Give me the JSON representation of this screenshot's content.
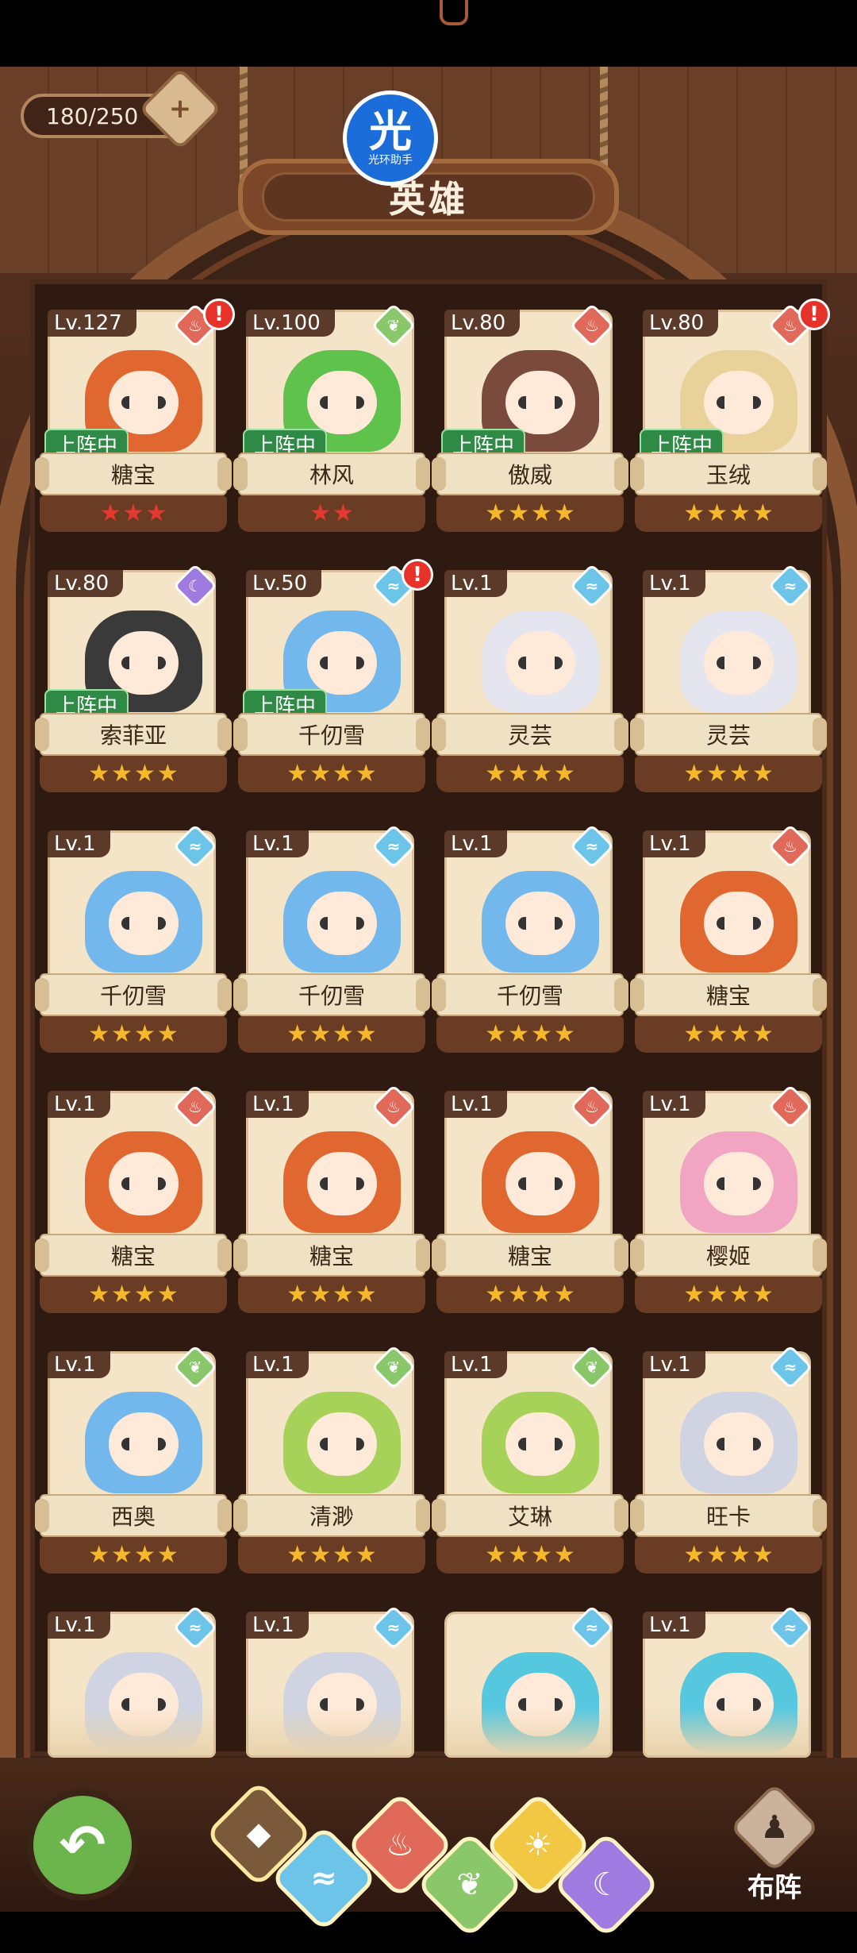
{
  "header": {
    "title": "英雄",
    "hero_count": "180/250",
    "plus_label": "+",
    "watermark": {
      "symbol": "光",
      "label": "光环助手"
    }
  },
  "colors": {
    "fire": "#e0695a",
    "water": "#6cc4e8",
    "nature": "#8ac76a",
    "dark": "#9f7ae0",
    "status_green": "#2f8a46"
  },
  "heroes": [
    {
      "level": "Lv.127",
      "name": "糖宝",
      "element": "fire",
      "status": "上阵中",
      "stars": 3,
      "star_color": "red",
      "alert": "!"
    },
    {
      "level": "Lv.100",
      "name": "林风",
      "element": "nature",
      "status": "上阵中",
      "stars": 2,
      "star_color": "red",
      "alert": ""
    },
    {
      "level": "Lv.80",
      "name": "傲威",
      "element": "fire",
      "status": "上阵中",
      "stars": 4,
      "star_color": "gold",
      "alert": ""
    },
    {
      "level": "Lv.80",
      "name": "玉绒",
      "element": "fire",
      "status": "上阵中",
      "stars": 4,
      "star_color": "gold",
      "alert": "!"
    },
    {
      "level": "Lv.80",
      "name": "索菲亚",
      "element": "dark",
      "status": "上阵中",
      "stars": 4,
      "star_color": "gold",
      "alert": ""
    },
    {
      "level": "Lv.50",
      "name": "千仞雪",
      "element": "water",
      "status": "上阵中",
      "stars": 4,
      "star_color": "gold",
      "alert": "!"
    },
    {
      "level": "Lv.1",
      "name": "灵芸",
      "element": "water",
      "status": "",
      "stars": 4,
      "star_color": "gold",
      "alert": ""
    },
    {
      "level": "Lv.1",
      "name": "灵芸",
      "element": "water",
      "status": "",
      "stars": 4,
      "star_color": "gold",
      "alert": ""
    },
    {
      "level": "Lv.1",
      "name": "千仞雪",
      "element": "water",
      "status": "",
      "stars": 4,
      "star_color": "gold",
      "alert": ""
    },
    {
      "level": "Lv.1",
      "name": "千仞雪",
      "element": "water",
      "status": "",
      "stars": 4,
      "star_color": "gold",
      "alert": ""
    },
    {
      "level": "Lv.1",
      "name": "千仞雪",
      "element": "water",
      "status": "",
      "stars": 4,
      "star_color": "gold",
      "alert": ""
    },
    {
      "level": "Lv.1",
      "name": "糖宝",
      "element": "fire",
      "status": "",
      "stars": 4,
      "star_color": "gold",
      "alert": ""
    },
    {
      "level": "Lv.1",
      "name": "糖宝",
      "element": "fire",
      "status": "",
      "stars": 4,
      "star_color": "gold",
      "alert": ""
    },
    {
      "level": "Lv.1",
      "name": "糖宝",
      "element": "fire",
      "status": "",
      "stars": 4,
      "star_color": "gold",
      "alert": ""
    },
    {
      "level": "Lv.1",
      "name": "糖宝",
      "element": "fire",
      "status": "",
      "stars": 4,
      "star_color": "gold",
      "alert": ""
    },
    {
      "level": "Lv.1",
      "name": "樱姬",
      "element": "fire",
      "status": "",
      "stars": 4,
      "star_color": "gold",
      "alert": ""
    },
    {
      "level": "Lv.1",
      "name": "西奥",
      "element": "nature",
      "status": "",
      "stars": 4,
      "star_color": "gold",
      "alert": ""
    },
    {
      "level": "Lv.1",
      "name": "清渺",
      "element": "nature",
      "status": "",
      "stars": 4,
      "star_color": "gold",
      "alert": ""
    },
    {
      "level": "Lv.1",
      "name": "艾琳",
      "element": "nature",
      "status": "",
      "stars": 4,
      "star_color": "gold",
      "alert": ""
    },
    {
      "level": "Lv.1",
      "name": "旺卡",
      "element": "water",
      "status": "",
      "stars": 4,
      "star_color": "gold",
      "alert": ""
    },
    {
      "level": "Lv.1",
      "name": "",
      "element": "water",
      "status": "",
      "stars": 0,
      "star_color": "gold",
      "alert": ""
    },
    {
      "level": "Lv.1",
      "name": "",
      "element": "water",
      "status": "",
      "stars": 0,
      "star_color": "gold",
      "alert": ""
    },
    {
      "level": "",
      "name": "",
      "element": "water",
      "status": "",
      "stars": 0,
      "star_color": "gold",
      "alert": ""
    },
    {
      "level": "Lv.1",
      "name": "",
      "element": "water",
      "status": "",
      "stars": 0,
      "star_color": "gold",
      "alert": ""
    }
  ],
  "filters": [
    {
      "id": "all",
      "icon": "all-elements-icon",
      "glyph": "◆"
    },
    {
      "id": "water",
      "icon": "water-icon",
      "glyph": "≈"
    },
    {
      "id": "fire",
      "icon": "fire-icon",
      "glyph": "♨"
    },
    {
      "id": "nature",
      "icon": "leaf-icon",
      "glyph": "❦"
    },
    {
      "id": "light",
      "icon": "sun-icon",
      "glyph": "☀"
    },
    {
      "id": "dark",
      "icon": "moon-icon",
      "glyph": "☾"
    }
  ],
  "footer": {
    "back_glyph": "↶",
    "formation_label": "布阵",
    "formation_glyph": "♟"
  }
}
